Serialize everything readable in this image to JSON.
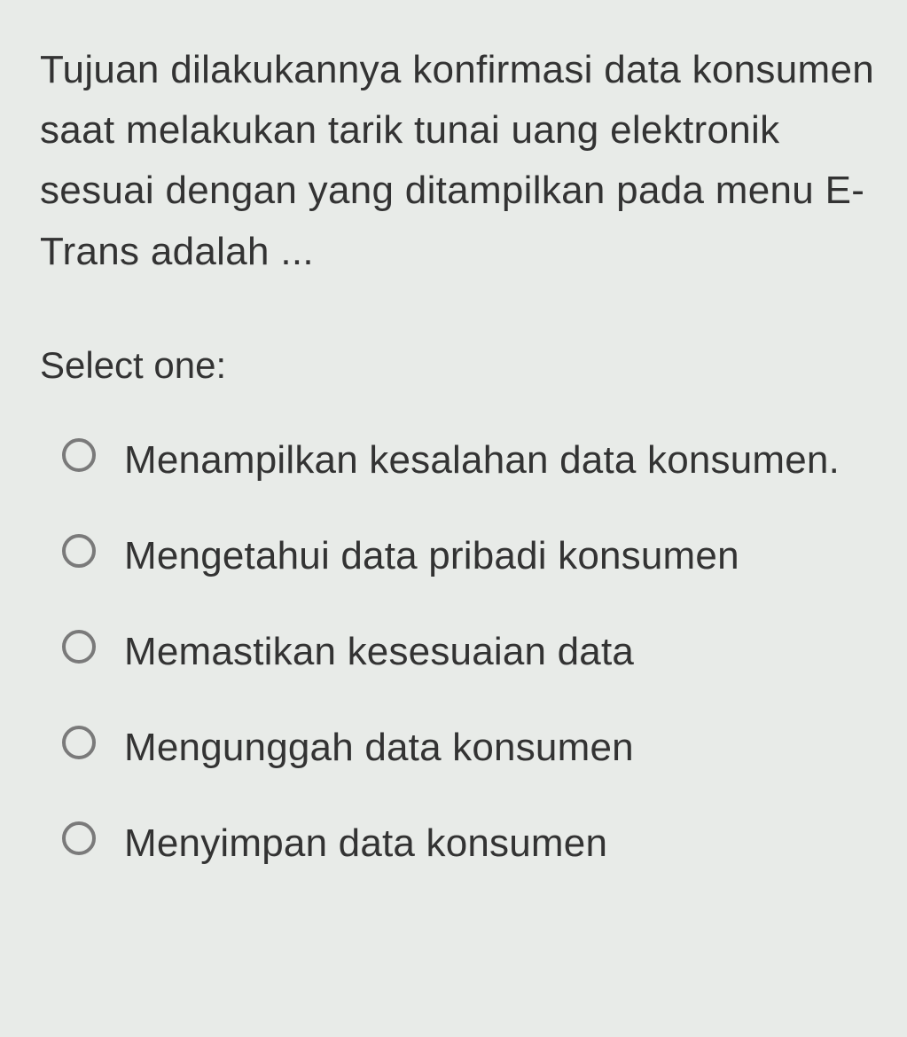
{
  "question": {
    "text": "Tujuan dilakukannya  konfirmasi data konsumen saat melakukan tarik tunai uang elektronik sesuai dengan yang ditampilkan pada menu E-Trans adalah ..."
  },
  "selectLabel": "Select one:",
  "options": [
    {
      "label": "Menampilkan kesalahan data konsumen."
    },
    {
      "label": "Mengetahui data pribadi konsumen"
    },
    {
      "label": "Memastikan kesesuaian data"
    },
    {
      "label": "Mengunggah data konsumen"
    },
    {
      "label": "Menyimpan data konsumen"
    }
  ]
}
